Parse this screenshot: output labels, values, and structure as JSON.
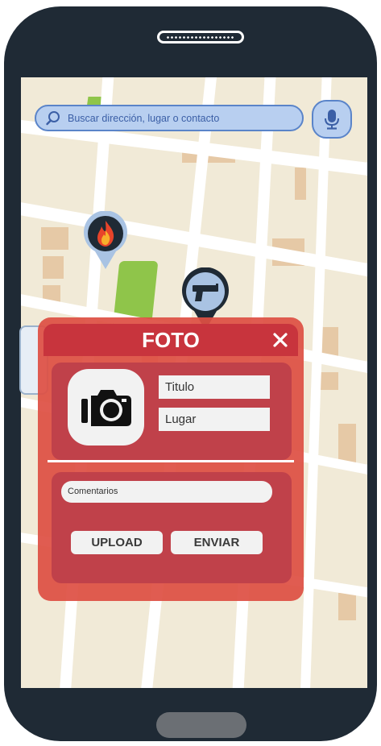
{
  "search": {
    "placeholder": "Buscar dirección, lugar o contacto",
    "icon": "search-icon",
    "mic_icon": "microphone-icon"
  },
  "map": {
    "markers": [
      "fire-icon",
      "gun-icon",
      "car-icon"
    ]
  },
  "dialog": {
    "title": "FOTO",
    "close_icon": "close-icon",
    "camera_icon": "camera-icon",
    "title_field": "Titulo",
    "place_field": "Lugar",
    "comments_field": "Comentarios",
    "upload_label": "UPLOAD",
    "send_label": "ENVIAR"
  },
  "colors": {
    "panel": "#de5044",
    "header": "#c8343d",
    "search_bg": "#b8cff0",
    "search_border": "#5a84c9",
    "map_bg": "#f1ead7",
    "park": "#8fc54a",
    "phone_body": "#1f2a35"
  }
}
